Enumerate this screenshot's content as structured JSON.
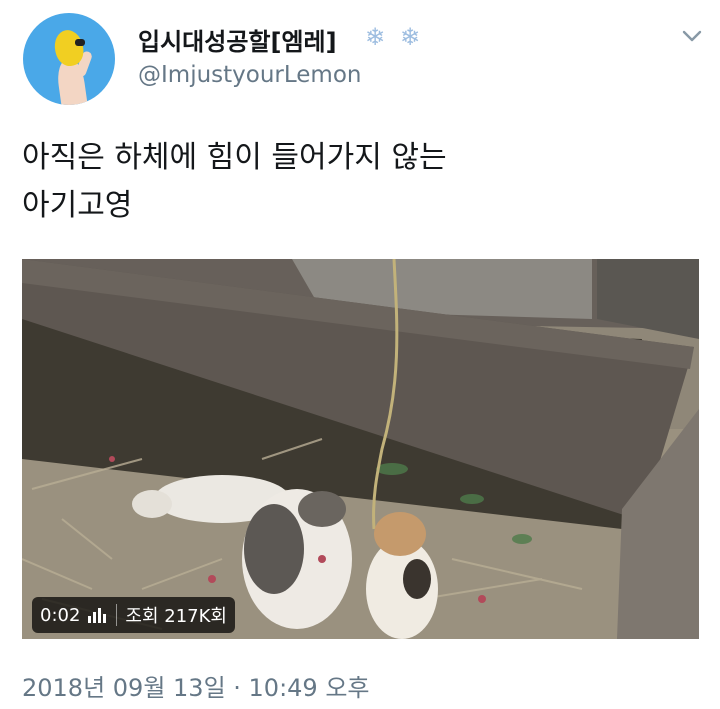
{
  "tweet": {
    "display_name": "입시대성공할[엠레]",
    "badges": [
      {
        "icon": "snowflake-icon",
        "glyph": "❄"
      },
      {
        "icon": "snowflake-icon",
        "glyph": "❄"
      }
    ],
    "handle": "@ImjustyourLemon",
    "text_lines": [
      "아직은 하체에 힘이 들어가지 않는",
      "아기고영"
    ],
    "timestamp": "2018년 09월 13일 · 10:49 오후"
  },
  "video": {
    "duration": "0:02",
    "views": "조회 217K회",
    "views_icon": "bars-icon"
  },
  "menu": {
    "icon": "chevron-down-icon"
  },
  "colors": {
    "text": "#14171a",
    "secondary": "#657786",
    "avatar_bg": "#4aa8e8",
    "badge": "#9dbde0"
  }
}
